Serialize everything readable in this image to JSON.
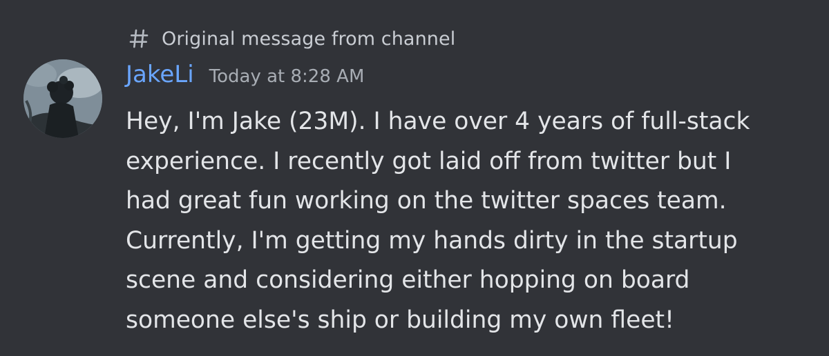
{
  "forwarded": {
    "icon": "hash-icon",
    "label": "Original message from channel"
  },
  "message": {
    "avatar_icon": "user-avatar",
    "author": "JakeLi",
    "timestamp": "Today at 8:28 AM",
    "content": "Hey, I'm Jake (23M). I have over 4 years of full-stack\nexperience. I recently got laid off from twitter but I\nhad great fun working on the twitter spaces team.\nCurrently, I'm getting my hands dirty in the startup\nscene and considering either hopping on board\nsomeone else's ship or building my own fleet!"
  },
  "colors": {
    "background": "#313338",
    "username": "#6aa6ff",
    "text": "#e3e5e8",
    "muted": "#a8adb4"
  }
}
